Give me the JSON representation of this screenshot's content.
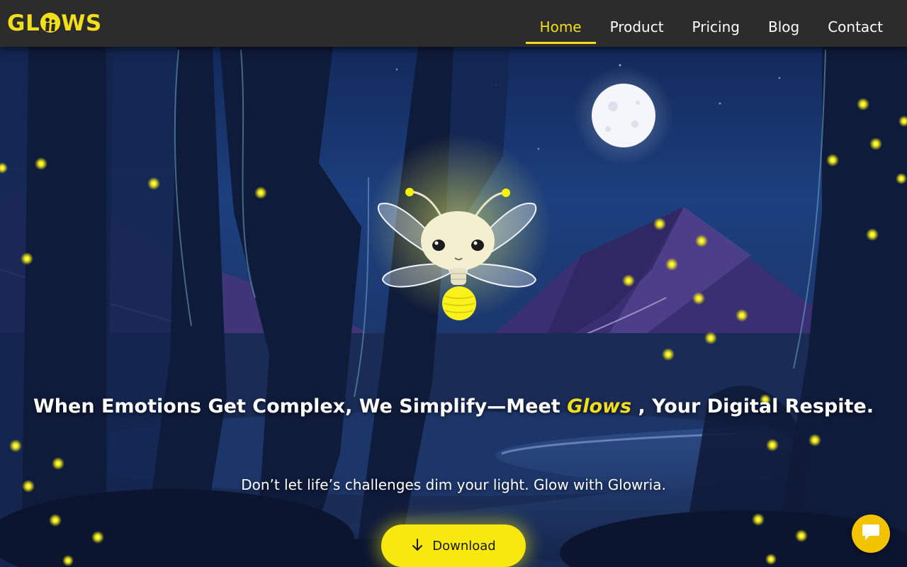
{
  "nav": {
    "logo_text_left": "GL",
    "logo_text_right": "WS",
    "logo_full": "GLOWS",
    "links": [
      {
        "label": "Home",
        "active": true
      },
      {
        "label": "Product",
        "active": false
      },
      {
        "label": "Pricing",
        "active": false
      },
      {
        "label": "Blog",
        "active": false
      },
      {
        "label": "Contact",
        "active": false
      }
    ]
  },
  "hero": {
    "headline_before": "When Emotions Get Complex, We Simplify—Meet",
    "headline_brand": "Glows",
    "headline_after": ", Your Digital Respite.",
    "subline": "Don’t let life’s challenges dim your light. Glow with Glowria.",
    "download_label": "Download",
    "download_icon": "arrow-down-icon"
  },
  "chat": {
    "icon": "chat-bubble-icon"
  },
  "colors": {
    "accent": "#f2de1a",
    "nav_bg": "#2b2c2b",
    "button": "#f7e80f",
    "chat": "#f2c300",
    "sky": "#1b3a78"
  }
}
